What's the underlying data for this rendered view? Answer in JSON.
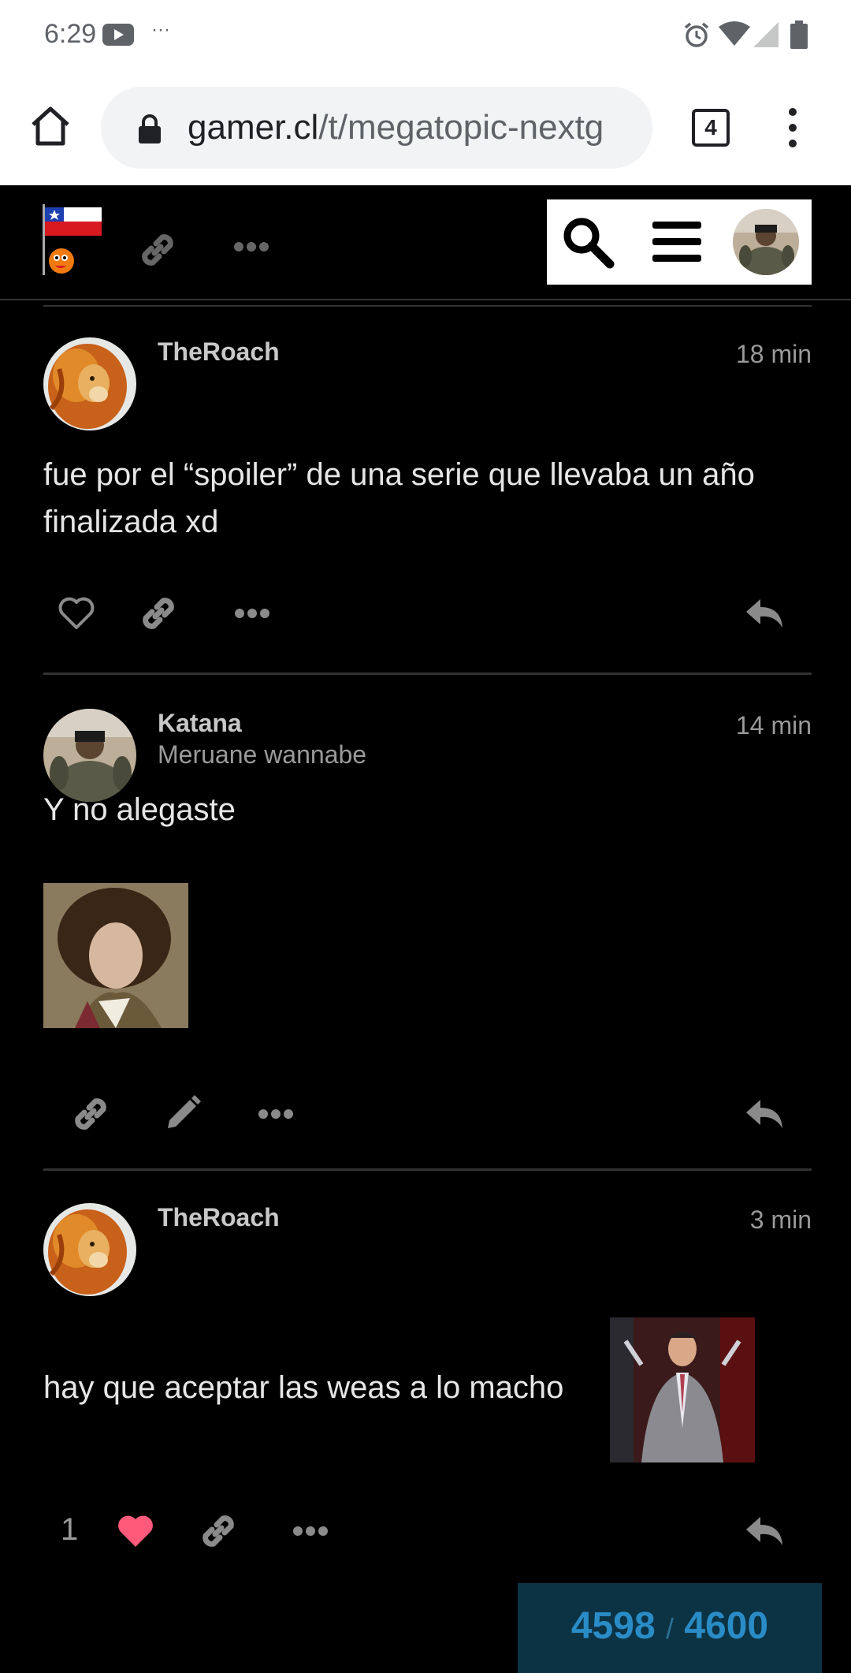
{
  "status_bar": {
    "time": "6:29",
    "dots": "···"
  },
  "browser": {
    "url_domain": "gamer.cl",
    "url_path": "/t/megatopic-nextg",
    "tab_count": "4"
  },
  "posts": [
    {
      "author": "TheRoach",
      "title": "",
      "age": "18 min",
      "text": "fue por el “spoiler” de una serie que llevaba un año finalizada xd"
    },
    {
      "author": "Katana",
      "title": "Meruane wannabe",
      "age": "14 min",
      "text": "Y no alegaste"
    },
    {
      "author": "TheRoach",
      "title": "",
      "age": "3 min",
      "text": "hay que aceptar las weas a lo macho",
      "like_count": "1"
    }
  ],
  "progress": {
    "current": "4598",
    "separator": "/",
    "total": "4600"
  },
  "colors": {
    "like": "#ff5a7a",
    "progress_bg": "#0c3344",
    "progress_text": "#2a8cc6"
  }
}
